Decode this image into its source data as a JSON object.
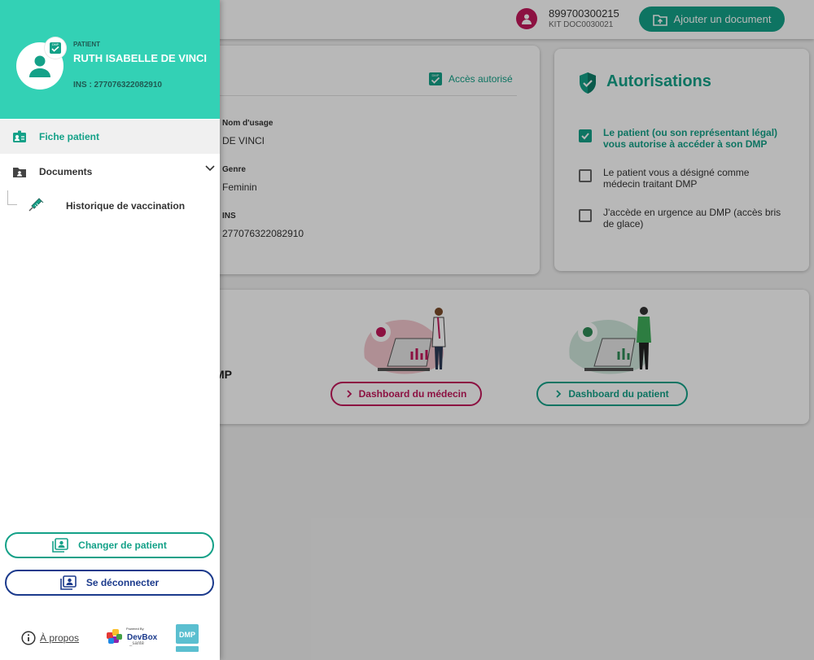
{
  "topbar": {
    "user_id": "899700300215",
    "user_kit": "KIT DOC0030021",
    "add_document_label": "Ajouter un document"
  },
  "patient_card": {
    "access_label": "Accès autorisé",
    "fields": [
      {
        "label": "Nom d'usage",
        "value": "DE VINCI"
      },
      {
        "label": "Genre",
        "value": "Feminin"
      },
      {
        "label": "INS",
        "value": "277076322082910"
      }
    ]
  },
  "authorisations": {
    "title": "Autorisations",
    "items": [
      {
        "text": "Le patient (ou son représentant légal) vous autorise à accéder à son DMP",
        "checked": true
      },
      {
        "text": "Le patient vous a désigné comme médecin traitant DMP",
        "checked": false
      },
      {
        "text": "J'accède en urgence au DMP (accès bris de glace)",
        "checked": false
      }
    ]
  },
  "dashboard": {
    "partial_text": "MP",
    "doctor_button": "Dashboard du médecin",
    "patient_button": "Dashboard du patient"
  },
  "drawer": {
    "kicker": "PATIENT",
    "patient_name": "RUTH ISABELLE DE VINCI",
    "ins": "INS : 277076322082910",
    "nav": {
      "fiche": "Fiche patient",
      "documents": "Documents",
      "vaccination": "Historique de vaccination"
    },
    "change_patient": "Changer de patient",
    "logout": "Se déconnecter",
    "about": "À propos",
    "devbox_powered": "Powered By",
    "devbox_name": "DevBox",
    "devbox_sub": "_santé",
    "dmp_logo_text": "DMP"
  },
  "colors": {
    "primary": "#14a188",
    "header": "#33d1b5",
    "doctor_accent": "#c2185b",
    "logout_blue": "#1b3a8c"
  }
}
